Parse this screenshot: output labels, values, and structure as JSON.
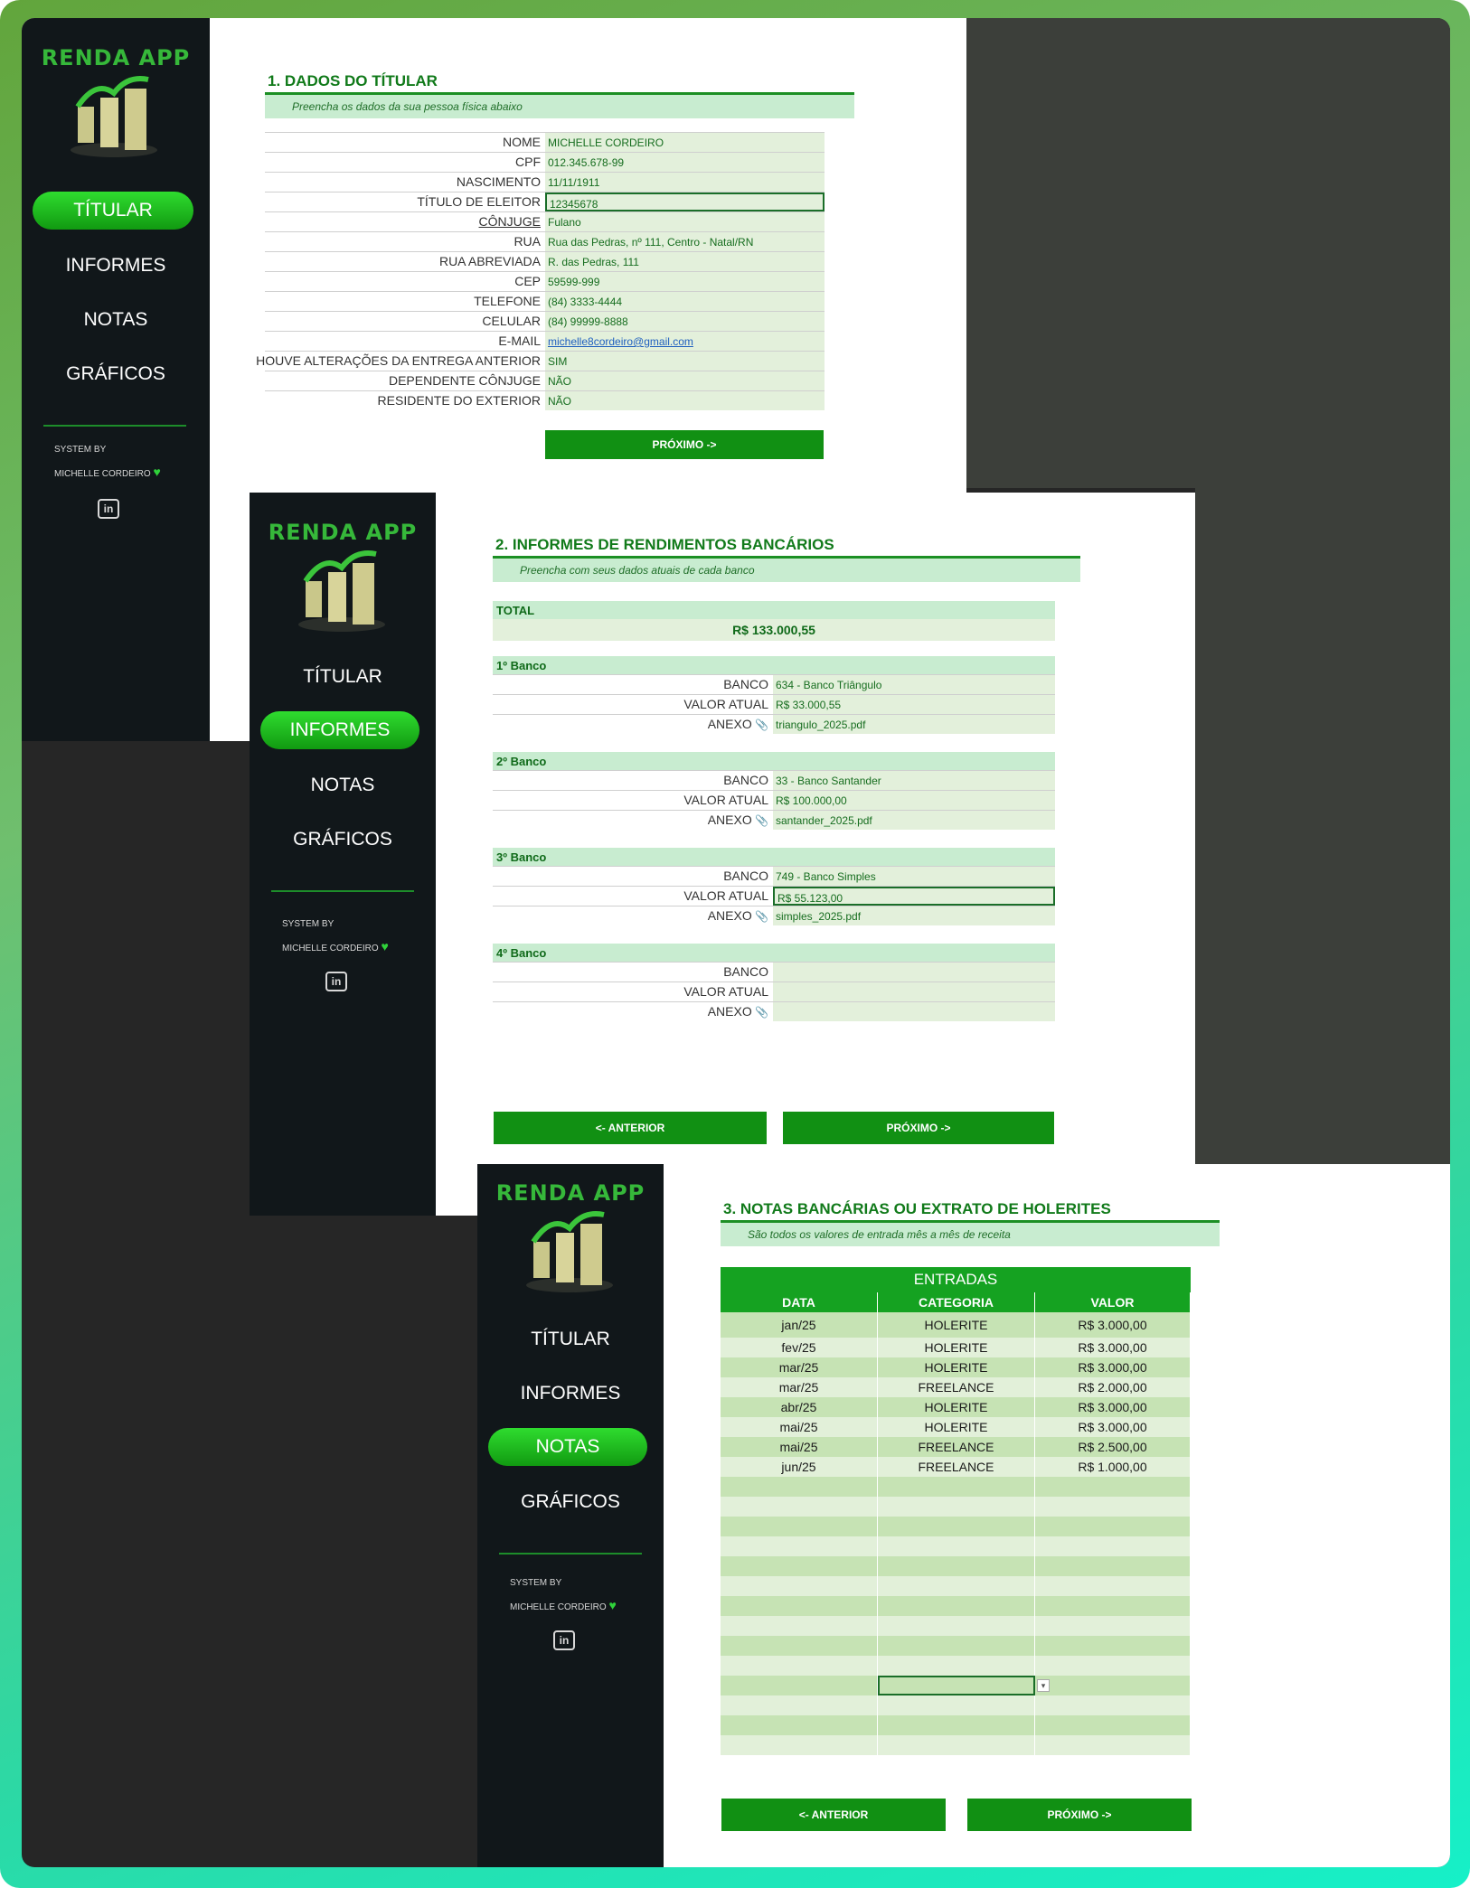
{
  "app": {
    "name": "RENDA APP",
    "system_by": "SYSTEM BY",
    "author": "MICHELLE CORDEIRO",
    "nav": [
      "TÍTULAR",
      "INFORMES",
      "NOTAS",
      "GRÁFICOS"
    ],
    "brand_color": "#36b83a",
    "accent": "#119013"
  },
  "screen1": {
    "active_nav": "TÍTULAR",
    "title": "1. DADOS DO TÍTULAR",
    "subtitle": "Preencha os dados da sua pessoa física abaixo",
    "fields": [
      {
        "label": "NOME",
        "value": "MICHELLE CORDEIRO"
      },
      {
        "label": "CPF",
        "value": "012.345.678-99"
      },
      {
        "label": "NASCIMENTO",
        "value": "11/11/1911"
      },
      {
        "label": "TÍTULO DE ELEITOR",
        "value": "12345678"
      },
      {
        "label": "CÔNJUGE",
        "value": "Fulano"
      },
      {
        "label": "RUA",
        "value": "Rua das Pedras, nº 111, Centro - Natal/RN"
      },
      {
        "label": "RUA ABREVIADA",
        "value": "R. das Pedras, 111"
      },
      {
        "label": "CEP",
        "value": "59599-999"
      },
      {
        "label": "TELEFONE",
        "value": "(84) 3333-4444"
      },
      {
        "label": "CELULAR",
        "value": "(84) 99999-8888"
      },
      {
        "label": "E-MAIL",
        "value": "michelle8cordeiro@gmail.com"
      },
      {
        "label": "HOUVE ALTERAÇÕES DA ENTREGA ANTERIOR",
        "value": "SIM"
      },
      {
        "label": "DEPENDENTE CÔNJUGE",
        "value": "NÃO"
      },
      {
        "label": "RESIDENTE DO EXTERIOR",
        "value": "NÃO"
      }
    ],
    "next_button": "PRÓXIMO ->"
  },
  "screen2": {
    "active_nav": "INFORMES",
    "title": "2. INFORMES DE RENDIMENTOS BANCÁRIOS",
    "subtitle": "Preencha com seus dados atuais de cada banco",
    "total_label": "TOTAL",
    "total_value": "R$ 133.000,55",
    "labels": {
      "bank": "BANCO",
      "value": "VALOR ATUAL",
      "attachment": "ANEXO"
    },
    "banks": [
      {
        "header": "1º Banco",
        "bank": "634 - Banco Triângulo",
        "value": "R$ 33.000,55",
        "attachment": "triangulo_2025.pdf"
      },
      {
        "header": "2º Banco",
        "bank": "33 - Banco Santander",
        "value": "R$ 100.000,00",
        "attachment": "santander_2025.pdf"
      },
      {
        "header": "3º Banco",
        "bank": "749 - Banco Simples",
        "value": "R$ 55.123,00",
        "attachment": "simples_2025.pdf"
      },
      {
        "header": "4º Banco",
        "bank": "",
        "value": "",
        "attachment": ""
      }
    ],
    "prev_button": "<- ANTERIOR",
    "next_button": "PRÓXIMO ->"
  },
  "screen3": {
    "active_nav": "NOTAS",
    "title": "3. NOTAS BANCÁRIAS OU EXTRATO DE HOLERITES",
    "subtitle": "São todos os valores de entrada mês a mês de receita",
    "table_title": "ENTRADAS",
    "columns": [
      "DATA",
      "CATEGORIA",
      "VALOR"
    ],
    "rows": [
      [
        "jan/25",
        "HOLERITE",
        "R$ 3.000,00"
      ],
      [
        "fev/25",
        "HOLERITE",
        "R$ 3.000,00"
      ],
      [
        "mar/25",
        "HOLERITE",
        "R$ 3.000,00"
      ],
      [
        "mar/25",
        "FREELANCE",
        "R$ 2.000,00"
      ],
      [
        "abr/25",
        "HOLERITE",
        "R$ 3.000,00"
      ],
      [
        "mai/25",
        "HOLERITE",
        "R$ 3.000,00"
      ],
      [
        "mai/25",
        "FREELANCE",
        "R$ 2.500,00"
      ],
      [
        "jun/25",
        "FREELANCE",
        "R$ 1.000,00"
      ]
    ],
    "prev_button": "<- ANTERIOR",
    "next_button": "PRÓXIMO ->"
  }
}
